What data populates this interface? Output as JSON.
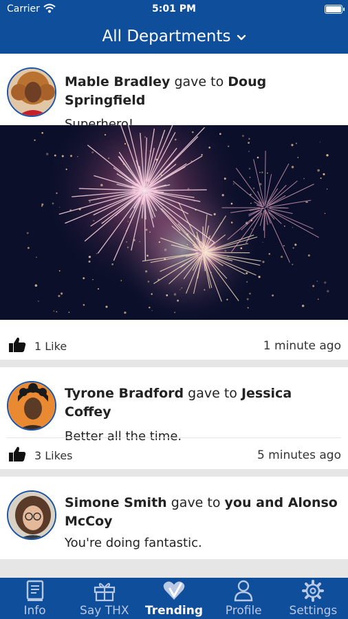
{
  "status_bar": {
    "carrier": "Carrier",
    "time": "5:01 PM"
  },
  "nav": {
    "title": "All Departments",
    "chevron_icon": "chevron-down-icon"
  },
  "feed": [
    {
      "giver": "Mable Bradley",
      "connector": "gave to",
      "recipient": "Doug Springfield",
      "message": "Superhero!",
      "image": "fireworks",
      "likes": "1 Like",
      "time": "1 minute ago"
    },
    {
      "giver": "Tyrone Bradford",
      "connector": "gave to",
      "recipient": "Jessica Coffey",
      "message": "Better all the time.",
      "likes": "3 Likes",
      "time": "5 minutes ago"
    },
    {
      "giver": "Simone Smith",
      "connector": "gave to",
      "recipient": "you and Alonso McCoy",
      "message": "You're doing fantastic."
    }
  ],
  "tabs": [
    {
      "label": "Info",
      "icon": "book-icon"
    },
    {
      "label": "Say THX",
      "icon": "gift-icon"
    },
    {
      "label": "Trending",
      "icon": "heart-check-icon",
      "active": true
    },
    {
      "label": "Profile",
      "icon": "user-icon"
    },
    {
      "label": "Settings",
      "icon": "gear-icon"
    }
  ],
  "colors": {
    "brand": "#0f4e9a",
    "avatar_ring": "#1b54a5",
    "tab_inactive": "#b9c9e4"
  }
}
